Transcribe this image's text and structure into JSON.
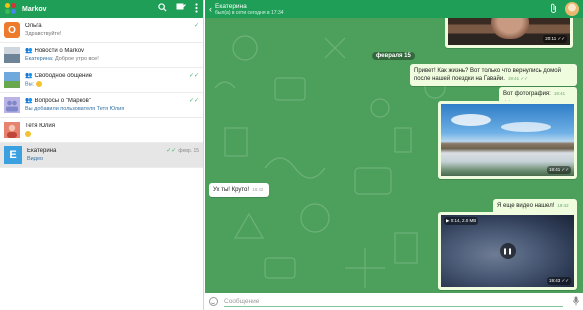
{
  "sidebar": {
    "title": "Markov",
    "header_icons": [
      "search-icon",
      "compose-icon",
      "more-vert-icon"
    ],
    "chats": [
      {
        "name": "Ольга",
        "group": false,
        "time": "",
        "ticks": "✓",
        "preview": "Здравствуйте!",
        "preview_sender": "",
        "avatar": {
          "kind": "letter",
          "letter": "О",
          "color": "#ee7a2c"
        },
        "active": false
      },
      {
        "name": "Новости о Markov",
        "group": true,
        "time": "",
        "ticks": "",
        "preview": "Доброе утро все!",
        "preview_sender": "Екатерина:",
        "avatar": {
          "kind": "image",
          "colors": [
            "#7b8fa0",
            "#d7dde4"
          ]
        },
        "active": false
      },
      {
        "name": "Свободное общение",
        "group": true,
        "time": "",
        "ticks": "✓✓",
        "preview": "",
        "preview_sender": "Вы:",
        "preview_emoji": true,
        "avatar": {
          "kind": "image",
          "colors": [
            "#5d9ad1",
            "#7db36a"
          ]
        },
        "active": false
      },
      {
        "name": "Вопросы о \"Марков\"",
        "group": true,
        "time": "",
        "ticks": "✓✓",
        "preview": "Вы добавили пользователя Тетя Юлия",
        "preview_sender": "",
        "avatar": {
          "kind": "image",
          "colors": [
            "#9da6d6",
            "#c6b9e8"
          ]
        },
        "active": false
      },
      {
        "name": "Тетя Юлия",
        "group": false,
        "time": "",
        "ticks": "",
        "preview": "",
        "preview_sender": "",
        "preview_emoji": true,
        "avatar": {
          "kind": "image",
          "colors": [
            "#e26a5b",
            "#f4b2a4"
          ]
        },
        "active": false
      },
      {
        "name": "Екатерина",
        "group": false,
        "time": "февр. 15",
        "ticks": "✓✓",
        "preview": "Видео",
        "preview_sender": "",
        "avatar": {
          "kind": "letter",
          "letter": "E",
          "color": "#3aa0e0"
        },
        "active": true
      }
    ]
  },
  "chat": {
    "peer_name": "Екатерина",
    "peer_status": "был(а) в сети сегодня в 17:34",
    "date_separator": "февраля 15",
    "messages": [
      {
        "kind": "photo_out",
        "time": "20:11"
      },
      {
        "kind": "text_out",
        "text": "Привет! Как жизнь? Вот только что вернулись домой после нашей поездки на Гавайи.",
        "time": "19:41"
      },
      {
        "kind": "text_out",
        "text": "Вот фотография:",
        "time": "19:41"
      },
      {
        "kind": "photo_out",
        "time": "19:41"
      },
      {
        "kind": "text_in",
        "text": "Ух ты! Круто!",
        "time": "19:42"
      },
      {
        "kind": "text_out",
        "text": "Я еще видео нашел!",
        "time": "19:42"
      },
      {
        "kind": "video_out",
        "badge": "0:14, 2.0 MB",
        "time": "19:43"
      }
    ],
    "input_placeholder": "Сообщение"
  },
  "colors": {
    "header_green": "#1e9e57",
    "wallpaper_green": "#4da05c",
    "out_bubble": "#effdde",
    "read_ticks": "#39b26a"
  }
}
